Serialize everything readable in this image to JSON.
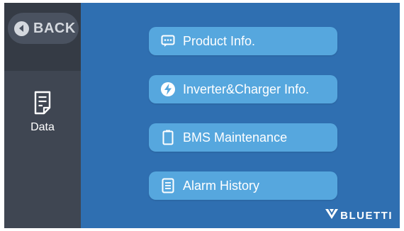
{
  "sidebar": {
    "back_label": "BACK",
    "items": [
      {
        "label": "Data",
        "icon": "document-icon"
      }
    ]
  },
  "menu": {
    "items": [
      {
        "label": "Product Info.",
        "icon": "chat-bubble-icon"
      },
      {
        "label": "Inverter&Charger Info.",
        "icon": "lightning-icon"
      },
      {
        "label": "BMS Maintenance",
        "icon": "battery-icon"
      },
      {
        "label": "Alarm History",
        "icon": "list-icon"
      }
    ]
  },
  "brand": {
    "name": "BLUETTI"
  },
  "colors": {
    "background": "#2f6fb1",
    "sidebar": "#3f4652",
    "button": "#56a7de",
    "text": "#ffffff"
  }
}
